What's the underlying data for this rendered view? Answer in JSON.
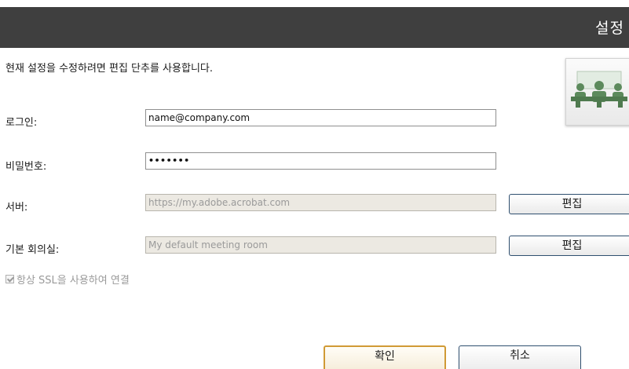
{
  "header": {
    "title": "설정"
  },
  "description": "현재 설정을 수정하려면 편집 단추를 사용합니다.",
  "app_icon": {
    "name": "meeting-room-icon",
    "color": "#5c8a5c"
  },
  "form": {
    "login": {
      "label": "로그인:",
      "value": "name@company.com"
    },
    "password": {
      "label": "비밀번호:",
      "value": "•••••••"
    },
    "server": {
      "label": "서버:",
      "value": "https://my.adobe.acrobat.com",
      "edit_label": "편집"
    },
    "meeting_room": {
      "label": "기본 회의실:",
      "value": "My default meeting room",
      "edit_label": "편집"
    },
    "ssl": {
      "label": "항상 SSL을 사용하여 연결",
      "checked": true
    }
  },
  "buttons": {
    "ok": "확인",
    "cancel": "취소"
  }
}
